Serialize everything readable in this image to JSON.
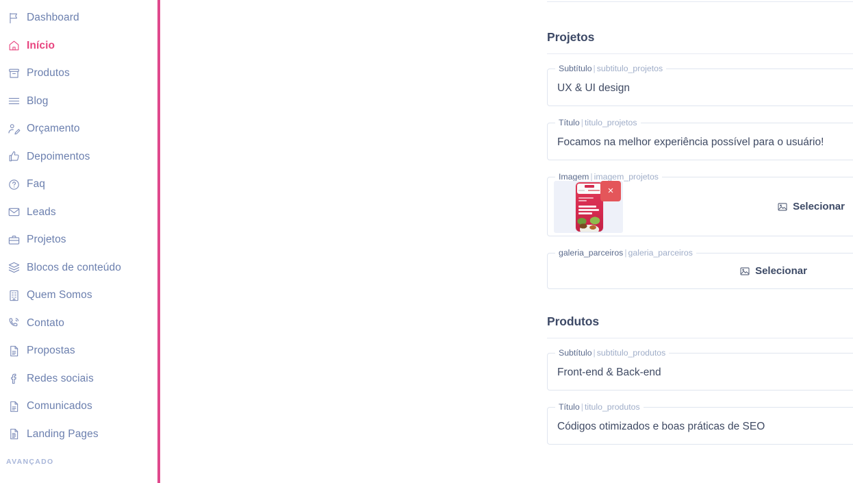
{
  "theme": {
    "accent": "#e0498d",
    "active_item": "#e8447f",
    "nav_text": "#6b7fae",
    "heading": "#3d4966",
    "field_border": "#dfe5ef",
    "delete_button": "#e4565a"
  },
  "sidebar": {
    "items": [
      {
        "label": "Dashboard",
        "icon": "flag-icon",
        "active": false
      },
      {
        "label": "Início",
        "icon": "home-icon",
        "active": true
      },
      {
        "label": "Produtos",
        "icon": "archive-box-icon",
        "active": false
      },
      {
        "label": "Blog",
        "icon": "list-lines-icon",
        "active": false
      },
      {
        "label": "Orçamento",
        "icon": "user-edit-icon",
        "active": false
      },
      {
        "label": "Depoimentos",
        "icon": "thumbs-up-icon",
        "active": false
      },
      {
        "label": "Faq",
        "icon": "question-circle-icon",
        "active": false
      },
      {
        "label": "Leads",
        "icon": "envelope-icon",
        "active": false
      },
      {
        "label": "Projetos",
        "icon": "briefcase-icon",
        "active": false
      },
      {
        "label": "Blocos de conteúdo",
        "icon": "layers-icon",
        "active": false
      },
      {
        "label": "Quem Somos",
        "icon": "building-icon",
        "active": false
      },
      {
        "label": "Contato",
        "icon": "phone-ring-icon",
        "active": false
      },
      {
        "label": "Propostas",
        "icon": "document-icon",
        "active": false
      },
      {
        "label": "Redes sociais",
        "icon": "facebook-icon",
        "active": false
      },
      {
        "label": "Comunicados",
        "icon": "document-icon",
        "active": false
      },
      {
        "label": "Landing Pages",
        "icon": "document-lines-icon",
        "active": false
      }
    ],
    "advanced_label": "AVANÇADO"
  },
  "main": {
    "sections": [
      {
        "title": "Projetos",
        "fields": [
          {
            "kind": "text",
            "legend_label": "Subtítulo",
            "legend_key": "subtitulo_projetos",
            "value": "UX & UI design"
          },
          {
            "kind": "text",
            "legend_label": "Título",
            "legend_key": "titulo_projetos",
            "value": "Focamos na melhor experiência possível para o usuário!"
          },
          {
            "kind": "image",
            "legend_label": "Imagem",
            "legend_key": "imagem_projetos",
            "has_thumbnail": true,
            "thumbnail_alt": "mobile app screenshot, red food delivery layout",
            "remove_label": "×",
            "select_label": "Selecionar"
          },
          {
            "kind": "gallery",
            "legend_label": "galeria_parceiros",
            "legend_key": "galeria_parceiros",
            "has_thumbnail": false,
            "select_label": "Selecionar"
          }
        ]
      },
      {
        "title": "Produtos",
        "fields": [
          {
            "kind": "text",
            "legend_label": "Subtítulo",
            "legend_key": "subtitulo_produtos",
            "value": "Front-end & Back-end"
          },
          {
            "kind": "text",
            "legend_label": "Título",
            "legend_key": "titulo_produtos",
            "value": "Códigos otimizados e boas práticas de SEO"
          }
        ]
      }
    ]
  }
}
